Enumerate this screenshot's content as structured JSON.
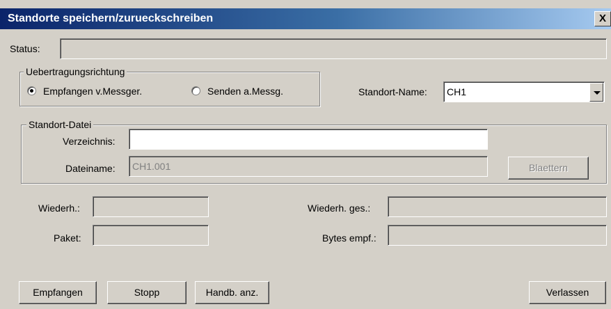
{
  "window": {
    "title": "Standorte speichern/zurueckschreiben",
    "close_glyph": "X"
  },
  "status": {
    "label": "Status:",
    "value": ""
  },
  "direction": {
    "legend": "Uebertragungsrichtung",
    "options": [
      {
        "label": "Empfangen v.Messger.",
        "checked": true
      },
      {
        "label": "Senden a.Messg.",
        "checked": false
      }
    ]
  },
  "location_name": {
    "label": "Standort-Name:",
    "value": "CH1"
  },
  "file_group": {
    "legend": "Standort-Datei",
    "directory": {
      "label": "Verzeichnis:",
      "value": ""
    },
    "filename": {
      "label": "Dateiname:",
      "value": "CH1.001"
    },
    "browse_label": "Blaettern"
  },
  "stats": {
    "repeat": {
      "label": "Wiederh.:",
      "value": ""
    },
    "packet": {
      "label": "Paket:",
      "value": ""
    },
    "repeat_total": {
      "label": "Wiederh. ges.:",
      "value": ""
    },
    "bytes_received": {
      "label": "Bytes empf.:",
      "value": ""
    }
  },
  "buttons": {
    "receive": "Empfangen",
    "stop": "Stopp",
    "manual": "Handb. anz.",
    "exit": "Verlassen"
  },
  "colors": {
    "dialog_bg": "#d4d0c8",
    "title_start": "#0a246a",
    "title_end": "#a6caf0"
  }
}
